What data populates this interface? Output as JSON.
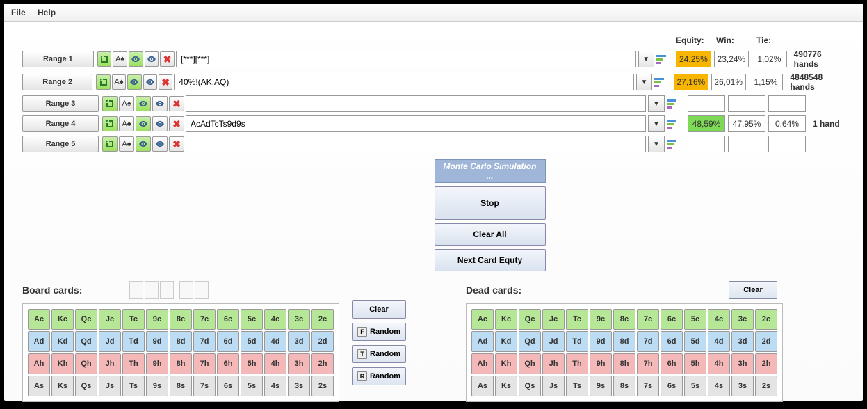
{
  "menu": {
    "file": "File",
    "help": "Help"
  },
  "headers": {
    "equity": "Equity:",
    "win": "Win:",
    "tie": "Tie:"
  },
  "ranges": [
    {
      "label": "Range 1",
      "text": "[***][***]",
      "equity": "24,25%",
      "win": "23,24%",
      "tie": "1,02%",
      "hands": "490776 hands",
      "eqClass": "stat-eq-yellow",
      "key": "r1"
    },
    {
      "label": "Range 2",
      "text": "40%!(AK,AQ)",
      "equity": "27,16%",
      "win": "26,01%",
      "tie": "1,15%",
      "hands": "4848548 hands",
      "eqClass": "stat-eq-yellow",
      "key": "r2"
    },
    {
      "label": "Range 3",
      "text": "",
      "equity": "",
      "win": "",
      "tie": "",
      "hands": "",
      "eqClass": "",
      "key": "r3"
    },
    {
      "label": "Range 4",
      "text": "AcAdTcTs9d9s",
      "equity": "48,59%",
      "win": "47,95%",
      "tie": "0,64%",
      "hands": "1 hand",
      "eqClass": "stat-eq-green",
      "key": "r4"
    },
    {
      "label": "Range 5",
      "text": "",
      "equity": "",
      "win": "",
      "tie": "",
      "hands": "",
      "eqClass": "",
      "key": "r5"
    }
  ],
  "sim": {
    "label": "Monte Carlo Simulation ...",
    "stop": "Stop",
    "clear_all": "Clear All",
    "next": "Next Card Equty"
  },
  "board": {
    "title": "Board cards:",
    "clear": "Clear",
    "random": "Random",
    "prefixes": {
      "f": "F",
      "t": "T",
      "r": "R"
    }
  },
  "dead": {
    "title": "Dead cards:",
    "clear": "Clear"
  },
  "ranks": [
    "A",
    "K",
    "Q",
    "J",
    "T",
    "9",
    "8",
    "7",
    "6",
    "5",
    "4",
    "3",
    "2"
  ],
  "suits": [
    "c",
    "d",
    "h",
    "s"
  ]
}
